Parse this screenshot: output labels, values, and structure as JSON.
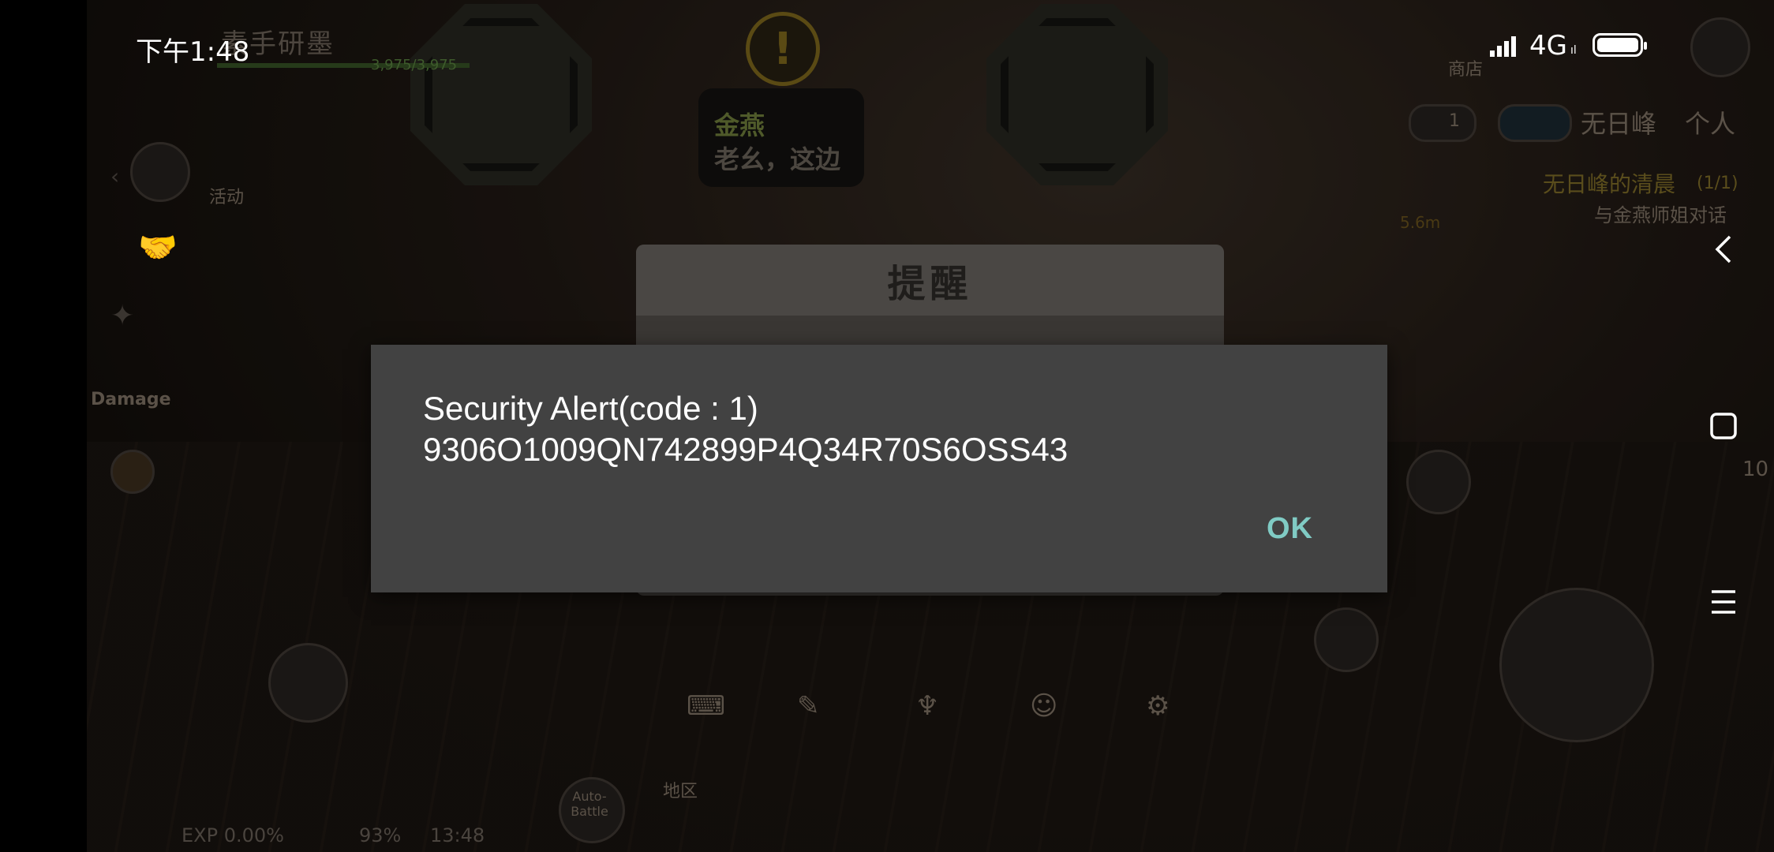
{
  "status_bar": {
    "time": "下午1:48",
    "network": "4G",
    "network_sub": "ıl"
  },
  "game_hud": {
    "player_name": "素手研墨",
    "hp_text": "3,975/3,975",
    "npc_name": "金燕",
    "npc_line": "老幺，这边",
    "quest_marker": "!",
    "activity_label": "活动",
    "damage_label": "Damage",
    "shop_label": "商店",
    "tab_location": "无日峰",
    "tab_personal": "个人",
    "mail_count": "1",
    "quest_title": "无日峰的清晨",
    "quest_progress": "(1/1)",
    "quest_desc": "与金燕师姐对话",
    "quest_distance": "5.6m",
    "region_label": "地区",
    "auto_battle": "Auto-Battle",
    "exp_text": "EXP 0.00%",
    "battery_pct": "93%",
    "clock": "13:48",
    "side_counter": "10",
    "game_dialog_title": "提醒"
  },
  "alert": {
    "message_line1": "Security Alert(code : 1)",
    "message_line2": "9306O1009QN742899P4Q34R70S6OSS43",
    "ok_label": "OK",
    "accent_color": "#80cbc4",
    "background_color": "#424242"
  }
}
